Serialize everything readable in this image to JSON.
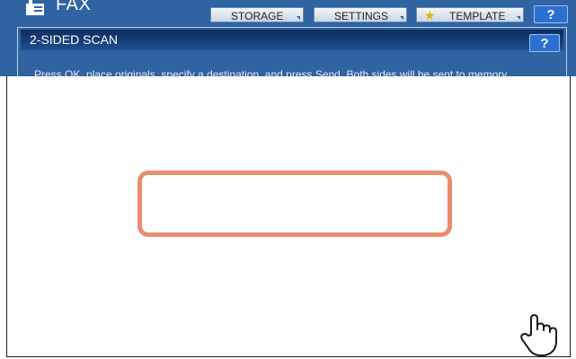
{
  "app": {
    "title": "FAX",
    "icon": "fax-icon"
  },
  "tabs": {
    "storage": "STORAGE",
    "settings": "SETTINGS",
    "template": "TEMPLATE",
    "help": "?"
  },
  "panel": {
    "title": "2-SIDED SCAN",
    "help": "?",
    "message": "Press OK, place originals, specify a destination, and press Send. Both sides will be sent to memory."
  },
  "icons": {
    "template_star": "star-icon",
    "pointer": "hand-pointer-icon"
  },
  "colors": {
    "header_blue": "#2f63a2",
    "highlight": "#e88e70"
  }
}
